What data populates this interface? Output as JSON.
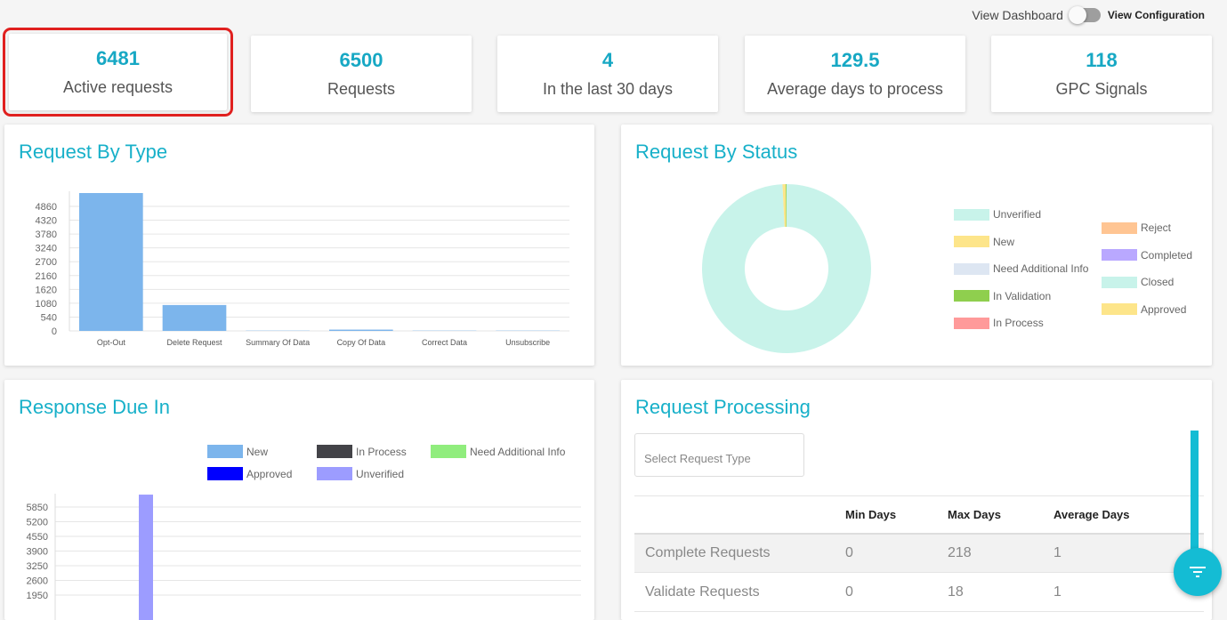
{
  "header": {
    "view_dashboard": "View Dashboard",
    "view_configuration": "View Configuration",
    "toggle_on": false
  },
  "stats": [
    {
      "value": "6481",
      "label": "Active requests",
      "selected": true
    },
    {
      "value": "6500",
      "label": "Requests"
    },
    {
      "value": "4",
      "label": "In the last 30 days"
    },
    {
      "value": "129.5",
      "label": "Average days to process"
    },
    {
      "value": "118",
      "label": "GPC Signals"
    }
  ],
  "panels": {
    "by_type": "Request By Type",
    "by_status": "Request By Status",
    "due_in": "Response Due In",
    "processing": "Request Processing"
  },
  "processing": {
    "select_placeholder": "Select Request Type",
    "columns": [
      "",
      "Min Days",
      "Max Days",
      "Average Days"
    ],
    "rows": [
      [
        "Complete Requests",
        "0",
        "218",
        "1"
      ],
      [
        "Validate Requests",
        "0",
        "18",
        "1"
      ]
    ]
  },
  "colors": {
    "accent": "#17b0c9",
    "selected_border": "#e0201f"
  },
  "chart_data": [
    {
      "type": "bar",
      "title": "Request By Type",
      "categories": [
        "Opt-Out",
        "Delete Request",
        "Summary Of Data",
        "Copy Of Data",
        "Correct Data",
        "Unsubscribe"
      ],
      "values": [
        5380,
        1010,
        10,
        50,
        10,
        10
      ],
      "yticks": [
        0,
        540,
        1080,
        1620,
        2160,
        2700,
        3240,
        3780,
        4320,
        4860
      ],
      "ylim": [
        0,
        5400
      ],
      "color": "#7cb5ec",
      "grid": true
    },
    {
      "type": "pie",
      "title": "Request By Status",
      "donut": true,
      "labels": [
        "Unverified",
        "New",
        "Need Additional Info",
        "In Validation",
        "In Process",
        "Reject",
        "Completed",
        "Closed",
        "Approved"
      ],
      "colors": [
        "#c8f3ea",
        "#fde58a",
        "#dde6f2",
        "#8fcf4e",
        "#ff9a9a",
        "#ffc593",
        "#b9a8ff",
        "#c8f3ea",
        "#fde58a"
      ],
      "values": [
        6420,
        40,
        0,
        10,
        0,
        0,
        0,
        0,
        0
      ]
    },
    {
      "type": "bar",
      "title": "Response Due In",
      "series": [
        {
          "name": "New",
          "color": "#7cb5ec",
          "values": [
            0
          ]
        },
        {
          "name": "In Process",
          "color": "#434348",
          "values": [
            0
          ]
        },
        {
          "name": "Need Additional Info",
          "color": "#90ed7d",
          "values": [
            0
          ]
        },
        {
          "name": "Approved",
          "color": "#0000ff",
          "values": [
            0
          ]
        },
        {
          "name": "Unverified",
          "color": "#9c9cff",
          "values": [
            6400
          ]
        }
      ],
      "yticks": [
        1950,
        2600,
        3250,
        3900,
        4550,
        5200,
        5850
      ],
      "grid": true
    }
  ]
}
